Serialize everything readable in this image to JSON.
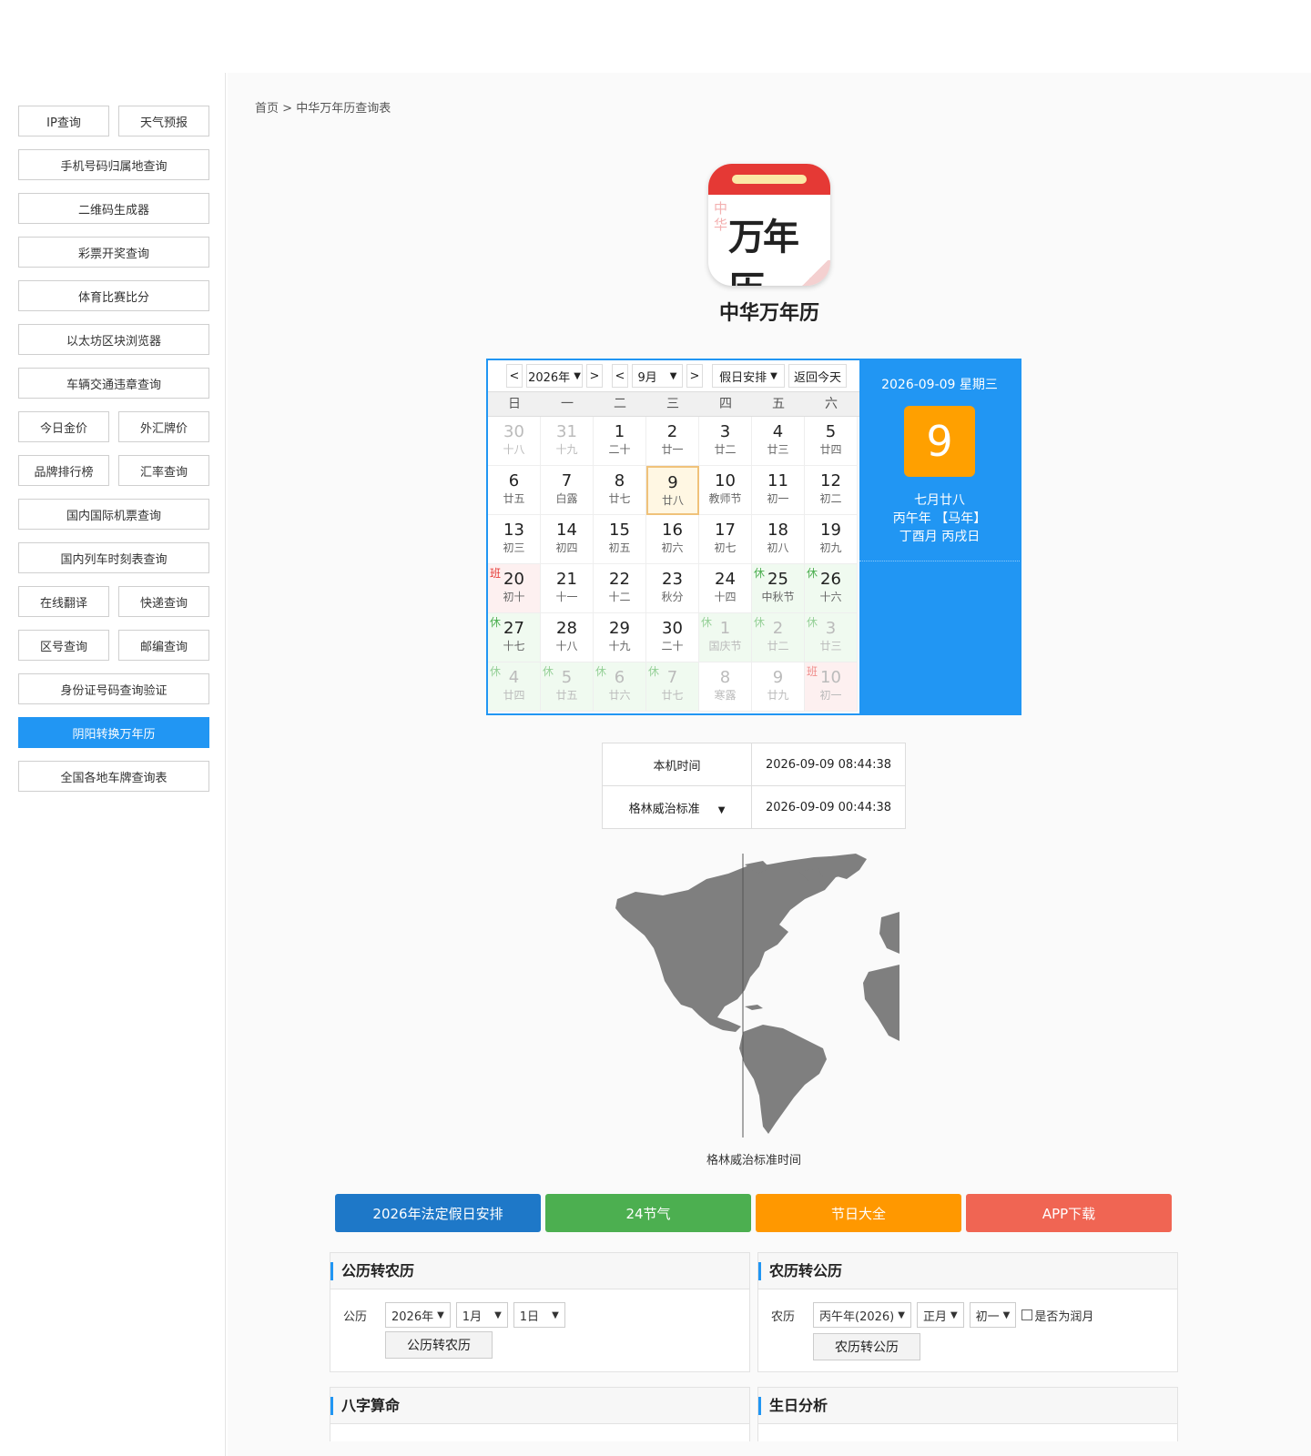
{
  "sidebar": {
    "rows": [
      [
        "IP查询",
        "天气预报"
      ],
      [
        "手机号码归属地查询"
      ],
      [
        "二维码生成器"
      ],
      [
        "彩票开奖查询"
      ],
      [
        "体育比赛比分"
      ],
      [
        "以太坊区块浏览器"
      ],
      [
        "车辆交通违章查询"
      ],
      [
        "今日金价",
        "外汇牌价"
      ],
      [
        "品牌排行榜",
        "汇率查询"
      ],
      [
        "国内国际机票查询"
      ],
      [
        "国内列车时刻表查询"
      ],
      [
        "在线翻译",
        "快递查询"
      ],
      [
        "区号查询",
        "邮编查询"
      ],
      [
        "身份证号码查询验证"
      ],
      [
        "阴阳转换万年历"
      ],
      [
        "全国各地车牌查询表"
      ]
    ],
    "active": "阴阳转换万年历"
  },
  "breadcrumb": {
    "home": "首页",
    "sep": ">",
    "current": "中华万年历查询表"
  },
  "logo": {
    "text": "万年历",
    "side": "中华"
  },
  "app_title": "中华万年历",
  "calendar": {
    "prev": "<",
    "next": ">",
    "year": "2026年",
    "month": "9月",
    "holiday_select": "假日安排",
    "today_btn": "返回今天",
    "weekdays": [
      "日",
      "一",
      "二",
      "三",
      "四",
      "五",
      "六"
    ],
    "days": [
      {
        "n": "30",
        "l": "十八",
        "other": true
      },
      {
        "n": "31",
        "l": "十九",
        "other": true
      },
      {
        "n": "1",
        "l": "二十"
      },
      {
        "n": "2",
        "l": "廿一"
      },
      {
        "n": "3",
        "l": "廿二"
      },
      {
        "n": "4",
        "l": "廿三"
      },
      {
        "n": "5",
        "l": "廿四"
      },
      {
        "n": "6",
        "l": "廿五"
      },
      {
        "n": "7",
        "l": "白露"
      },
      {
        "n": "8",
        "l": "廿七"
      },
      {
        "n": "9",
        "l": "廿八",
        "today": true
      },
      {
        "n": "10",
        "l": "教师节"
      },
      {
        "n": "11",
        "l": "初一"
      },
      {
        "n": "12",
        "l": "初二"
      },
      {
        "n": "13",
        "l": "初三"
      },
      {
        "n": "14",
        "l": "初四"
      },
      {
        "n": "15",
        "l": "初五"
      },
      {
        "n": "16",
        "l": "初六"
      },
      {
        "n": "17",
        "l": "初七"
      },
      {
        "n": "18",
        "l": "初八"
      },
      {
        "n": "19",
        "l": "初九"
      },
      {
        "n": "20",
        "l": "初十",
        "tag": "班"
      },
      {
        "n": "21",
        "l": "十一"
      },
      {
        "n": "22",
        "l": "十二"
      },
      {
        "n": "23",
        "l": "秋分"
      },
      {
        "n": "24",
        "l": "十四"
      },
      {
        "n": "25",
        "l": "中秋节",
        "tag": "休"
      },
      {
        "n": "26",
        "l": "十六",
        "tag": "休"
      },
      {
        "n": "27",
        "l": "十七",
        "tag": "休"
      },
      {
        "n": "28",
        "l": "十八"
      },
      {
        "n": "29",
        "l": "十九"
      },
      {
        "n": "30",
        "l": "二十"
      },
      {
        "n": "1",
        "l": "国庆节",
        "tag": "休",
        "other": true
      },
      {
        "n": "2",
        "l": "廿二",
        "tag": "休",
        "other": true
      },
      {
        "n": "3",
        "l": "廿三",
        "tag": "休",
        "other": true
      },
      {
        "n": "4",
        "l": "廿四",
        "tag": "休",
        "other": true
      },
      {
        "n": "5",
        "l": "廿五",
        "tag": "休",
        "other": true
      },
      {
        "n": "6",
        "l": "廿六",
        "tag": "休",
        "other": true
      },
      {
        "n": "7",
        "l": "廿七",
        "tag": "休",
        "other": true
      },
      {
        "n": "8",
        "l": "寒露",
        "other": true
      },
      {
        "n": "9",
        "l": "廿九",
        "other": true
      },
      {
        "n": "10",
        "l": "初一",
        "tag": "班",
        "other": true
      }
    ],
    "side": {
      "date": "2026-09-09 星期三",
      "big": "9",
      "lunar": "七月廿八",
      "year_gz": "丙午年 【马年】",
      "month_day_gz": "丁酉月 丙戌日"
    }
  },
  "time": {
    "local_label": "本机时间",
    "local_value": "2026-09-09 08:44:38",
    "zone_label": "格林威治标准",
    "zone_value": "2026-09-09 00:44:38"
  },
  "map_caption": "格林威治标准时间",
  "quick_buttons": [
    {
      "label": "2026年法定假日安排",
      "color": "#1e78c8"
    },
    {
      "label": "24节气",
      "color": "#4caf50"
    },
    {
      "label": "节日大全",
      "color": "#ff9800"
    },
    {
      "label": "APP下载",
      "color": "#f06553"
    }
  ],
  "solar_to_lunar": {
    "title": "公历转农历",
    "label": "公历",
    "year": "2026年",
    "month": "1月",
    "day": "1日",
    "button": "公历转农历"
  },
  "lunar_to_solar": {
    "title": "农历转公历",
    "label": "农历",
    "year": "丙午年(2026)",
    "month": "正月",
    "day": "初一",
    "leap_label": "是否为润月",
    "button": "农历转公历"
  },
  "bazi": {
    "title": "八字算命"
  },
  "birthday": {
    "title": "生日分析"
  }
}
